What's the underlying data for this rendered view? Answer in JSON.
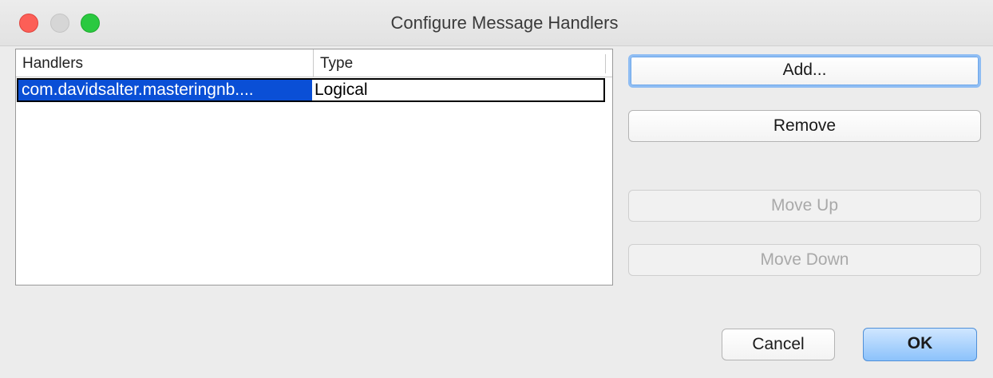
{
  "window": {
    "title": "Configure Message Handlers"
  },
  "table": {
    "columns": [
      "Handlers",
      "Type"
    ],
    "rows": [
      {
        "handler": "com.davidsalter.masteringnb....",
        "type": "Logical",
        "selected": true
      }
    ]
  },
  "buttons": {
    "add": "Add...",
    "remove": "Remove",
    "move_up": "Move Up",
    "move_down": "Move Down",
    "cancel": "Cancel",
    "ok": "OK"
  },
  "colors": {
    "selection": "#0a4fd6",
    "close": "#fc5f57",
    "maximize": "#2ac940"
  }
}
